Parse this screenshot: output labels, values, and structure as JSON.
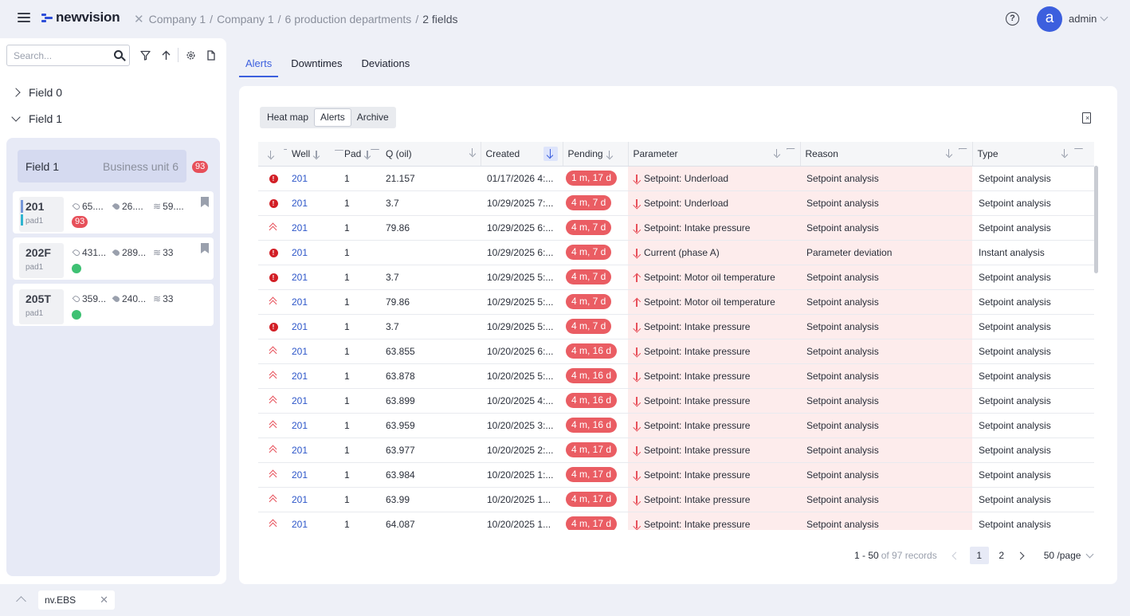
{
  "header": {
    "brand": "newvision",
    "breadcrumb": [
      "Company 1",
      "Company 1",
      "6 production departments",
      "2 fields"
    ],
    "user_initial": "a",
    "user_name": "admin"
  },
  "sidebar": {
    "search_placeholder": "Search...",
    "tree": [
      {
        "label": "Field 0",
        "expanded": false
      },
      {
        "label": "Field 1",
        "expanded": true
      }
    ],
    "field_header": {
      "name": "Field 1",
      "business_unit": "Business unit 6",
      "badge": "93"
    },
    "wells": [
      {
        "name": "201",
        "pad": "pad1",
        "m1": "65....",
        "m2": "26....",
        "m3": "59....",
        "badge": "93",
        "status": "badge"
      },
      {
        "name": "202F",
        "pad": "pad1",
        "m1": "431...",
        "m2": "289...",
        "m3": "33",
        "status": "green"
      },
      {
        "name": "205T",
        "pad": "pad1",
        "m1": "359...",
        "m2": "240...",
        "m3": "33",
        "status": "green"
      }
    ],
    "bottom_tab": "nv.EBS"
  },
  "tabs": [
    "Alerts",
    "Downtimes",
    "Deviations"
  ],
  "active_tab": "Alerts",
  "segments": [
    "Heat map",
    "Alerts",
    "Archive"
  ],
  "active_segment": "Alerts",
  "table": {
    "columns": {
      "well": "Well",
      "pad": "Pad",
      "q_oil": "Q (oil)",
      "created": "Created",
      "pending": "Pending",
      "parameter": "Parameter",
      "reason": "Reason",
      "type": "Type"
    },
    "rows": [
      {
        "status": "error",
        "well": "201",
        "pad": "1",
        "q": "21.157",
        "created": "01/17/2026 4:...",
        "pending": "1 m, 17 d",
        "dir": "down",
        "parameter": "Setpoint: Underload",
        "reason": "Setpoint analysis",
        "type": "Setpoint analysis"
      },
      {
        "status": "error",
        "well": "201",
        "pad": "1",
        "q": "3.7",
        "created": "10/29/2025 7:...",
        "pending": "4 m, 7 d",
        "dir": "down",
        "parameter": "Setpoint: Underload",
        "reason": "Setpoint analysis",
        "type": "Setpoint analysis"
      },
      {
        "status": "up",
        "well": "201",
        "pad": "1",
        "q": "79.86",
        "created": "10/29/2025 6:...",
        "pending": "4 m, 7 d",
        "dir": "down",
        "parameter": "Setpoint: Intake pressure",
        "reason": "Setpoint analysis",
        "type": "Setpoint analysis"
      },
      {
        "status": "error",
        "well": "201",
        "pad": "1",
        "q": "",
        "created": "10/29/2025 6:...",
        "pending": "4 m, 7 d",
        "dir": "down",
        "parameter": "Current (phase A)",
        "reason": "Parameter deviation",
        "type": "Instant analysis"
      },
      {
        "status": "error",
        "well": "201",
        "pad": "1",
        "q": "3.7",
        "created": "10/29/2025 5:...",
        "pending": "4 m, 7 d",
        "dir": "up",
        "parameter": "Setpoint: Motor oil temperature",
        "reason": "Setpoint analysis",
        "type": "Setpoint analysis"
      },
      {
        "status": "up",
        "well": "201",
        "pad": "1",
        "q": "79.86",
        "created": "10/29/2025 5:...",
        "pending": "4 m, 7 d",
        "dir": "up",
        "parameter": "Setpoint: Motor oil temperature",
        "reason": "Setpoint analysis",
        "type": "Setpoint analysis"
      },
      {
        "status": "error",
        "well": "201",
        "pad": "1",
        "q": "3.7",
        "created": "10/29/2025 5:...",
        "pending": "4 m, 7 d",
        "dir": "down",
        "parameter": "Setpoint: Intake pressure",
        "reason": "Setpoint analysis",
        "type": "Setpoint analysis"
      },
      {
        "status": "up",
        "well": "201",
        "pad": "1",
        "q": "63.855",
        "created": "10/20/2025 6:...",
        "pending": "4 m, 16 d",
        "dir": "down",
        "parameter": "Setpoint: Intake pressure",
        "reason": "Setpoint analysis",
        "type": "Setpoint analysis"
      },
      {
        "status": "up",
        "well": "201",
        "pad": "1",
        "q": "63.878",
        "created": "10/20/2025 5:...",
        "pending": "4 m, 16 d",
        "dir": "down",
        "parameter": "Setpoint: Intake pressure",
        "reason": "Setpoint analysis",
        "type": "Setpoint analysis"
      },
      {
        "status": "up",
        "well": "201",
        "pad": "1",
        "q": "63.899",
        "created": "10/20/2025 4:...",
        "pending": "4 m, 16 d",
        "dir": "down",
        "parameter": "Setpoint: Intake pressure",
        "reason": "Setpoint analysis",
        "type": "Setpoint analysis"
      },
      {
        "status": "up",
        "well": "201",
        "pad": "1",
        "q": "63.959",
        "created": "10/20/2025 3:...",
        "pending": "4 m, 16 d",
        "dir": "down",
        "parameter": "Setpoint: Intake pressure",
        "reason": "Setpoint analysis",
        "type": "Setpoint analysis"
      },
      {
        "status": "up",
        "well": "201",
        "pad": "1",
        "q": "63.977",
        "created": "10/20/2025 2:...",
        "pending": "4 m, 17 d",
        "dir": "down",
        "parameter": "Setpoint: Intake pressure",
        "reason": "Setpoint analysis",
        "type": "Setpoint analysis"
      },
      {
        "status": "up",
        "well": "201",
        "pad": "1",
        "q": "63.984",
        "created": "10/20/2025 1:...",
        "pending": "4 m, 17 d",
        "dir": "down",
        "parameter": "Setpoint: Intake pressure",
        "reason": "Setpoint analysis",
        "type": "Setpoint analysis"
      },
      {
        "status": "up",
        "well": "201",
        "pad": "1",
        "q": "63.99",
        "created": "10/20/2025 1...",
        "pending": "4 m, 17 d",
        "dir": "down",
        "parameter": "Setpoint: Intake pressure",
        "reason": "Setpoint analysis",
        "type": "Setpoint analysis"
      },
      {
        "status": "up",
        "well": "201",
        "pad": "1",
        "q": "64.087",
        "created": "10/20/2025 1...",
        "pending": "4 m, 17 d",
        "dir": "down",
        "parameter": "Setpoint: Intake pressure",
        "reason": "Setpoint analysis",
        "type": "Setpoint analysis"
      }
    ]
  },
  "pagination": {
    "range": "1 - 50",
    "total_text": "of 97 records",
    "pages": [
      "1",
      "2"
    ],
    "current_page": "1",
    "page_size": "50 /page"
  },
  "colors": {
    "accent": "#3c5fde",
    "alert_red": "#e7505a",
    "error_red": "#d21f26",
    "ok_green": "#3ec173",
    "row_highlight": "#fdecec"
  }
}
